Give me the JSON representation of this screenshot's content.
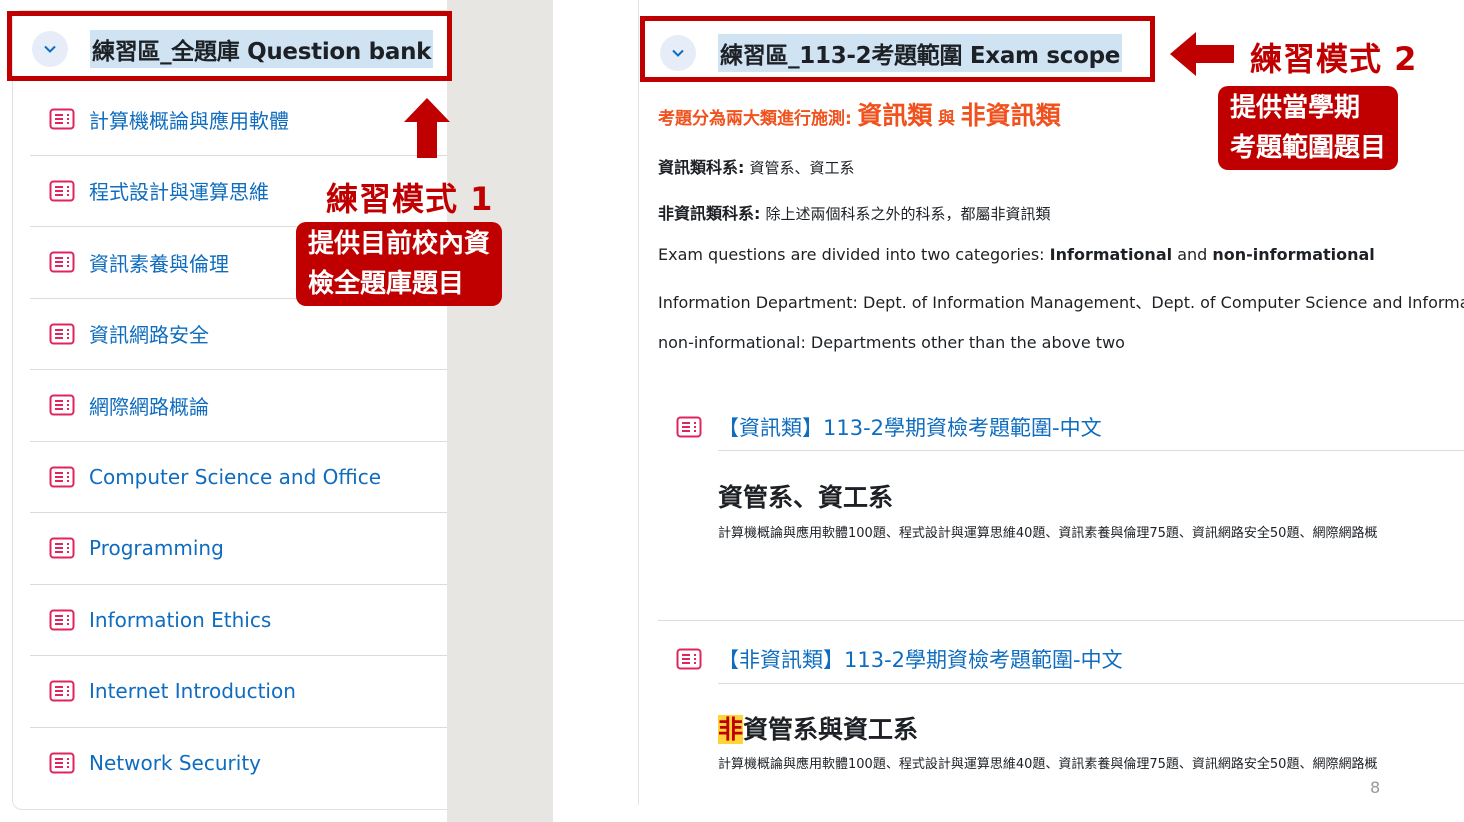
{
  "left": {
    "section_title": "練習區_全題庫 Question bank",
    "items": [
      {
        "label": "計算機概論與應用軟體"
      },
      {
        "label": "程式設計與運算思維"
      },
      {
        "label": "資訊素養與倫理"
      },
      {
        "label": "資訊網路安全"
      },
      {
        "label": "網際網路概論"
      },
      {
        "label": "Computer Science and Office"
      },
      {
        "label": "Programming"
      },
      {
        "label": "Information Ethics"
      },
      {
        "label": "Internet Introduction"
      },
      {
        "label": "Network Security"
      }
    ]
  },
  "annotation1": {
    "title": "練習模式 1",
    "box_line1": "提供目前校內資",
    "box_line2": "檢全題庫題目"
  },
  "right": {
    "section_title": "練習區_113-2考題範圍 Exam scope",
    "heading_prefix": "考題分為兩大類進行施測:",
    "heading_cat1": "資訊類",
    "heading_and": "與",
    "heading_cat2": "非資訊類",
    "info_dept_label": "資訊類科系:",
    "info_dept_value": "資管系、資工系",
    "non_info_label": "非資訊類科系:",
    "non_info_value": "除上述兩個科系之外的科系，都屬非資訊類",
    "en_line1_prefix": "Exam questions are divided into two categories:",
    "en_line1_b1": "Informational",
    "en_line1_and": "and",
    "en_line1_b2": "non-informational",
    "en_line2": "Information Department:  Dept. of Information Management、Dept. of Computer Science and Information",
    "en_line3": "non-informational:  Departments other than the above two",
    "items": [
      {
        "link": "【資訊類】113-2學期資檢考題範圍-中文",
        "sub_title": "資管系、資工系",
        "detail": "計算機概論與應用軟體100題、程式設計與運算思維40題、資訊素養與倫理75題、資訊網路安全50題、網際網路概"
      },
      {
        "link": "【非資訊類】113-2學期資檢考題範圍-中文",
        "sub_title_hl": "非",
        "sub_title_rest": "資管系與資工系",
        "detail": "計算機概論與應用軟體100題、程式設計與運算思維40題、資訊素養與倫理75題、資訊網路安全50題、網際網路概"
      }
    ]
  },
  "annotation2": {
    "title": "練習模式 2",
    "box_line1": "提供當學期",
    "box_line2": "考題範圍題目"
  },
  "page_number": "8",
  "colors": {
    "annotation_red": "#c00000",
    "link_blue": "#0f6cbf",
    "heading_orange": "#f0511d",
    "title_highlight": "#cfe3f3",
    "icon_pink": "#e0245e"
  },
  "icons": [
    "chevron-down-icon",
    "quiz-icon",
    "arrow-up-icon",
    "arrow-left-icon"
  ]
}
